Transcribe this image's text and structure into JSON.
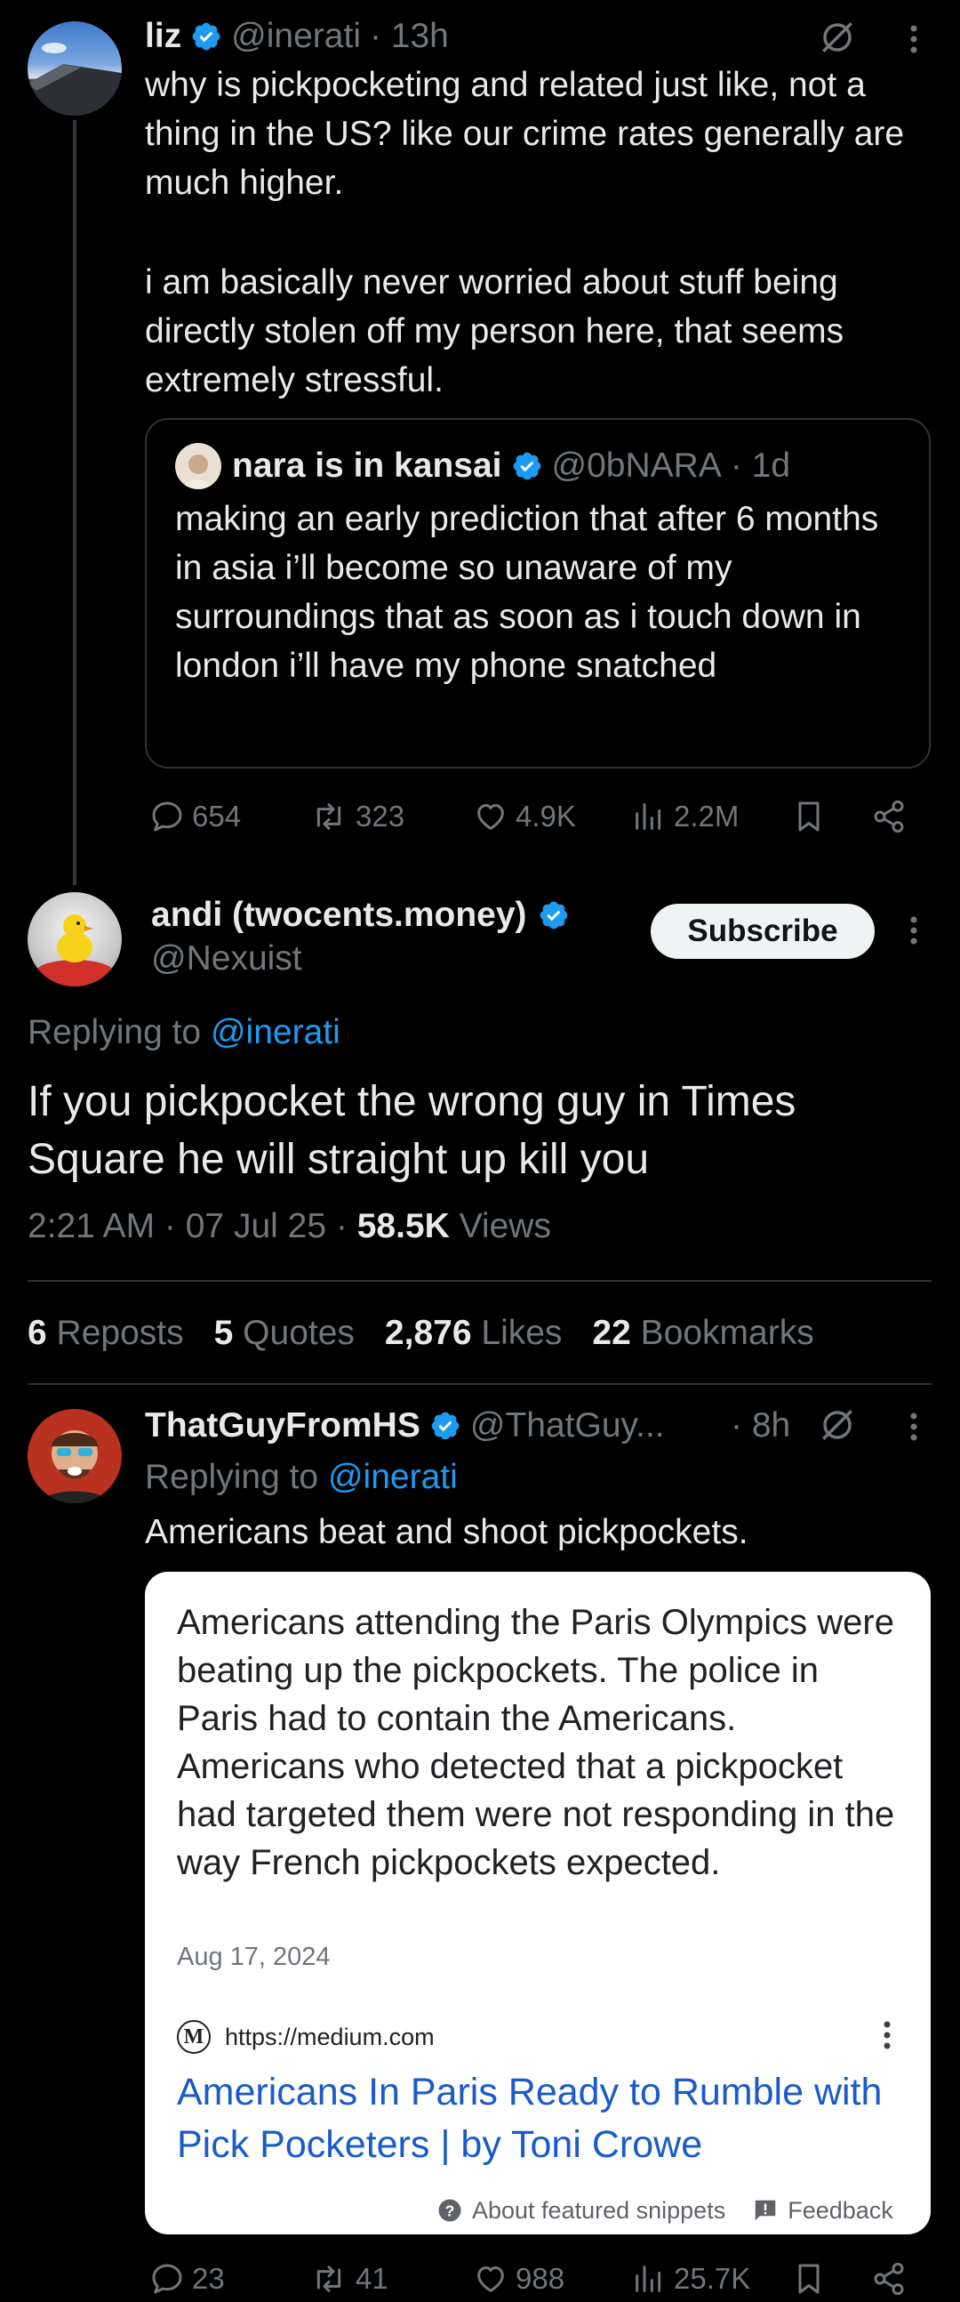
{
  "tweet1": {
    "name": "liz",
    "handle": "@inerati",
    "time": "· 13h",
    "text1": "why is pickpocketing and related just like, not a thing in the US? like our crime rates generally are much higher.",
    "text2": "i am basically never worried about stuff being directly stolen off my person here, that seems extremely stressful.",
    "quote": {
      "name": "nara is in kansai",
      "handle": "@0bNARA",
      "time": "· 1d",
      "text": "making an early prediction that after 6 months in asia i’ll become so unaware of my surroundings that as soon as i touch down in london i’ll have my phone snatched"
    },
    "replies": "654",
    "reposts": "323",
    "likes": "4.9K",
    "views": "2.2M"
  },
  "main": {
    "name": "andi (twocents.money)",
    "handle": "@Nexuist",
    "subscribe": "Subscribe",
    "replying_prefix": "Replying to",
    "replying_to": "@inerati",
    "text": "If you pickpocket the wrong guy in Times Square he will straight up kill you",
    "time": "2:21 AM · 07 Jul 25 · ",
    "views_count": "58.5K",
    "views_label": "Views",
    "reposts_count": "6",
    "reposts_label": "Reposts",
    "quotes_count": "5",
    "quotes_label": "Quotes",
    "likes_count": "2,876",
    "likes_label": "Likes",
    "bookmarks_count": "22",
    "bookmarks_label": "Bookmarks"
  },
  "reply": {
    "name": "ThatGuyFromHS",
    "handle": "@ThatGuy...",
    "time": "· 8h",
    "replying_prefix": "Replying to",
    "replying_to": "@inerati",
    "text": "Americans beat and shoot pickpockets.",
    "snippet": {
      "text": "Americans attending the Paris Olympics were beating up the pickpockets. The police in Paris had to contain the Americans. Americans who detected that a pickpocket had targeted them were not responding in the way French pickpockets expected.",
      "date": "Aug 17, 2024",
      "favicon": "M",
      "url": "https://medium.com",
      "link": "Americans In Paris Ready to Rumble with Pick Pocketers | by Toni Crowe",
      "about": "About featured snippets",
      "feedback": "Feedback"
    },
    "replies": "23",
    "reposts": "41",
    "likes": "988",
    "views": "25.7K"
  },
  "colors": {
    "accent": "#1d9bf0",
    "background": "#000000",
    "muted": "#71767b"
  }
}
